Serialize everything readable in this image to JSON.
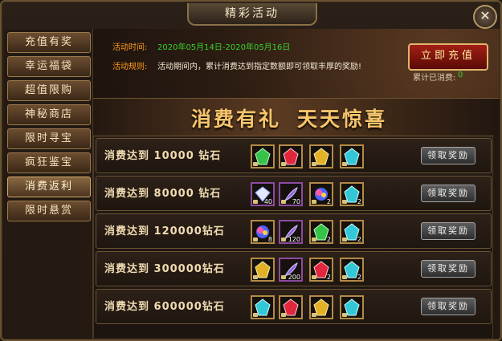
{
  "window": {
    "title": "精彩活动",
    "close_icon": "close-icon"
  },
  "sidebar": {
    "items": [
      {
        "label": "充值有奖"
      },
      {
        "label": "幸运福袋"
      },
      {
        "label": "超值限购"
      },
      {
        "label": "神秘商店"
      },
      {
        "label": "限时寻宝"
      },
      {
        "label": "疯狂鉴宝"
      },
      {
        "label": "消费返利",
        "active": true
      },
      {
        "label": "限时悬赏"
      }
    ]
  },
  "banner": {
    "time_label": "活动时间:",
    "time_value": "2020年05月14日-2020年05月16日",
    "rule_label": "活动规则:",
    "rule_value": "活动期间内，累计消费达到指定数额即可领取丰厚的奖励!",
    "recharge_label": "立即充值",
    "consumed_label": "累计已消费:",
    "consumed_value": "0"
  },
  "promo": {
    "left": "消费有礼",
    "right": "天天惊喜"
  },
  "rewards": [
    {
      "condition": "消费达到 10000 钻石",
      "claim_label": "领取奖励",
      "items": [
        {
          "icon": "green-crystal-icon",
          "count": ""
        },
        {
          "icon": "red-crystal-icon",
          "count": ""
        },
        {
          "icon": "gold-crystal-icon",
          "count": ""
        },
        {
          "icon": "cyan-crystal-icon",
          "count": ""
        }
      ]
    },
    {
      "condition": "消费达到 80000 钻石",
      "claim_label": "领取奖励",
      "items": [
        {
          "icon": "white-diamond-icon",
          "count": "40"
        },
        {
          "icon": "purple-feather-icon",
          "count": "70"
        },
        {
          "icon": "rainbow-orb-icon",
          "count": "2"
        },
        {
          "icon": "cyan-crystal-icon",
          "count": "2"
        }
      ]
    },
    {
      "condition": "消费达到 120000钻石",
      "claim_label": "领取奖励",
      "items": [
        {
          "icon": "rainbow-orb-icon",
          "count": "8"
        },
        {
          "icon": "purple-feather-icon",
          "count": "120"
        },
        {
          "icon": "green-crystal-icon",
          "count": "2"
        },
        {
          "icon": "cyan-crystal-icon",
          "count": "2"
        }
      ]
    },
    {
      "condition": "消费达到 300000钻石",
      "claim_label": "领取奖励",
      "items": [
        {
          "icon": "gold-crystal-icon",
          "count": ""
        },
        {
          "icon": "purple-feather-icon",
          "count": "200"
        },
        {
          "icon": "red-crystal-icon",
          "count": "2"
        },
        {
          "icon": "cyan-crystal-icon",
          "count": "2"
        }
      ]
    },
    {
      "condition": "消费达到 600000钻石",
      "claim_label": "领取奖励",
      "items": [
        {
          "icon": "cyan-crystal-icon",
          "count": ""
        },
        {
          "icon": "red-crystal-icon",
          "count": ""
        },
        {
          "icon": "gold-crystal-icon",
          "count": ""
        },
        {
          "icon": "cyan-crystal-icon",
          "count": ""
        }
      ]
    }
  ],
  "colors": {
    "label_orange": "#ff9a1a",
    "date_green": "#37d22e",
    "gold": "#f7c56b"
  }
}
